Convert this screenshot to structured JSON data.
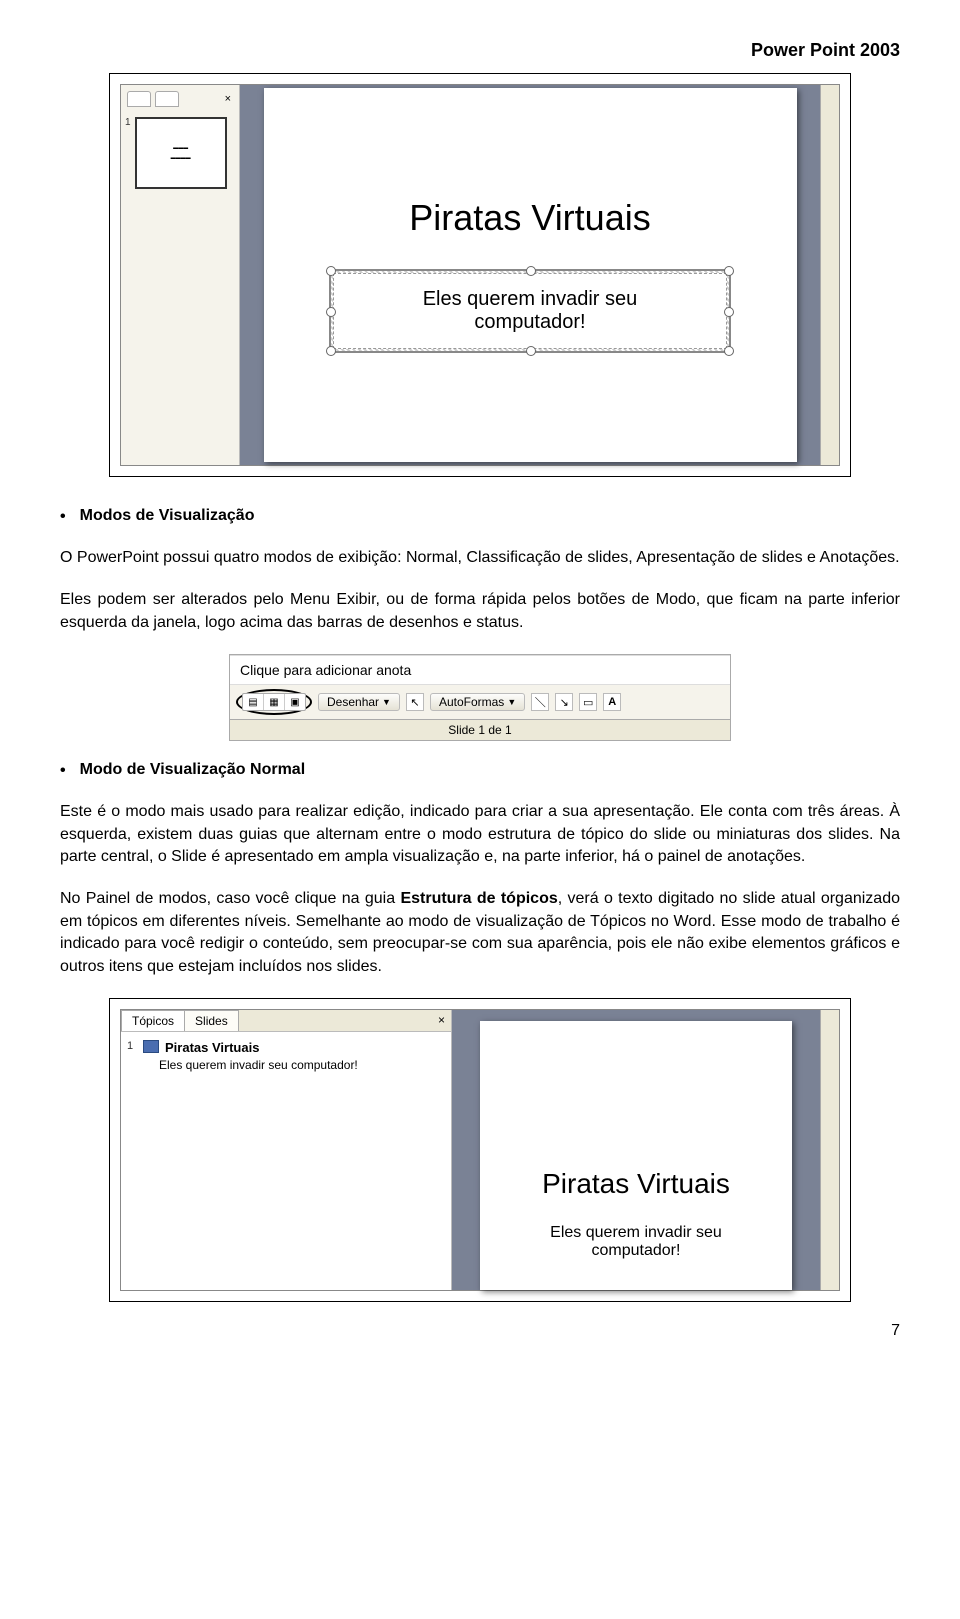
{
  "header": {
    "title": "Power Point 2003"
  },
  "screenshot1": {
    "thumb_num": "1",
    "slide_title": "Piratas Virtuais",
    "slide_sub_line1": "Eles querem invadir seu",
    "slide_sub_line2": "computador!"
  },
  "section1": {
    "heading": "Modos de Visualização",
    "p1": "O PowerPoint possui quatro modos de exibição: Normal, Classificação de slides, Apresentação de slides e Anotações.",
    "p2": "Eles podem ser alterados pelo Menu Exibir, ou de forma rápida pelos botões de Modo, que ficam na parte inferior esquerda da janela, logo acima das barras de desenhos e status."
  },
  "toolbar": {
    "notes_placeholder": "Clique para adicionar anota",
    "draw_label": "Desenhar",
    "autoshapes_label": "AutoFormas",
    "status": "Slide 1 de 1"
  },
  "section2": {
    "heading": "Modo de Visualização Normal",
    "p1": "Este é o modo mais usado para realizar edição, indicado para criar a sua apresentação. Ele conta com três áreas. À esquerda, existem duas guias que alternam entre o modo estrutura de tópico do slide ou miniaturas dos slides. Na parte central, o Slide é apresentado em ampla visualização e, na parte inferior, há o painel de anotações.",
    "p2a": "No Painel de modos, caso você clique na guia ",
    "p2b": "Estrutura de tópicos",
    "p2c": ", verá o texto digitado no slide atual organizado em tópicos em diferentes níveis. Semelhante ao modo de visualização de Tópicos no Word. Esse modo de trabalho é indicado para você redigir o conteúdo, sem preocupar-se com sua aparência, pois ele não exibe elementos gráficos e outros itens que estejam incluídos nos slides."
  },
  "screenshot2": {
    "tab_topics": "Tópicos",
    "tab_slides": "Slides",
    "close": "×",
    "out_num": "1",
    "out_title": "Piratas Virtuais",
    "out_sub": "Eles querem invadir seu computador!",
    "slide_title": "Piratas Virtuais",
    "slide_sub_line1": "Eles querem invadir seu",
    "slide_sub_line2": "computador!"
  },
  "pagenum": "7"
}
